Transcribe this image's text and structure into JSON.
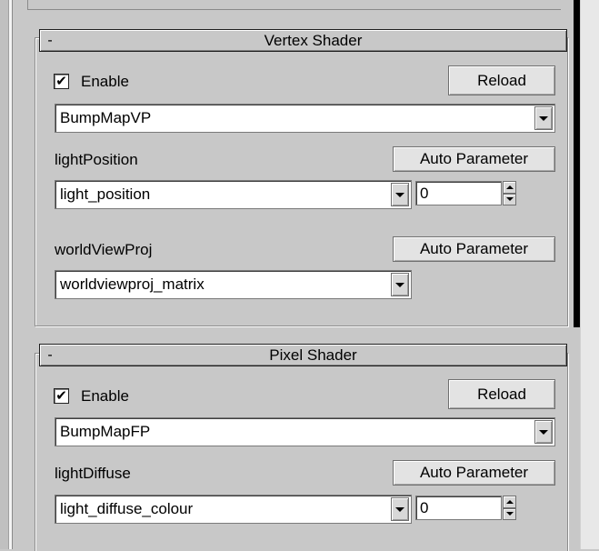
{
  "vertex_shader": {
    "title": "Vertex Shader",
    "collapse_symbol": "-",
    "enable_label": "Enable",
    "enable_checked": true,
    "check_mark": "✔",
    "reload_label": "Reload",
    "program_value": "BumpMapVP",
    "params": [
      {
        "name": "lightPosition",
        "auto_label": "Auto Parameter",
        "value": "light_position",
        "index": "0"
      },
      {
        "name": "worldViewProj",
        "auto_label": "Auto Parameter",
        "value": "worldviewproj_matrix"
      }
    ]
  },
  "pixel_shader": {
    "title": "Pixel Shader",
    "collapse_symbol": "-",
    "enable_label": "Enable",
    "enable_checked": true,
    "check_mark": "✔",
    "reload_label": "Reload",
    "program_value": "BumpMapFP",
    "params": [
      {
        "name": "lightDiffuse",
        "auto_label": "Auto Parameter",
        "value": "light_diffuse_colour",
        "index": "0"
      }
    ]
  },
  "colors": {
    "panel_bg": "#c8c8c8",
    "button_bg": "#e3e3e3",
    "field_bg": "#ffffff",
    "scroll_thumb": "#000000"
  }
}
